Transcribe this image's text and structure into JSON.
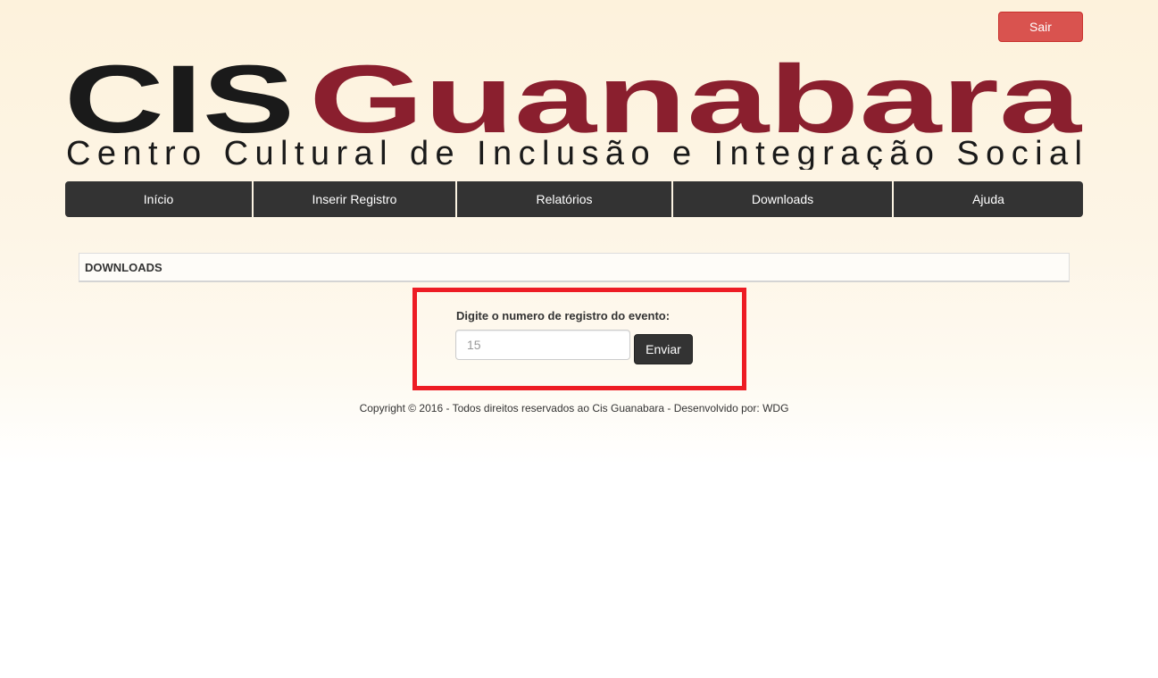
{
  "header": {
    "logout_label": "Sair",
    "logo": {
      "part1": "CIS",
      "part2": "Guanabara",
      "tagline": "Centro Cultural de Inclusão e Integração Social"
    }
  },
  "nav": {
    "items": [
      {
        "label": "Início"
      },
      {
        "label": "Inserir Registro"
      },
      {
        "label": "Relatórios"
      },
      {
        "label": "Downloads"
      },
      {
        "label": "Ajuda"
      }
    ]
  },
  "panel": {
    "title": "DOWNLOADS"
  },
  "form": {
    "label": "Digite o numero de registro do evento:",
    "placeholder": "15",
    "value": "",
    "submit_label": "Enviar"
  },
  "footer": {
    "text": "Copyright © 2016 - Todos direitos reservados ao Cis Guanabara - Desenvolvido por: WDG"
  },
  "colors": {
    "logo_dark": "#1a1a1a",
    "logo_accent": "#8a1f2e",
    "logout_button": "#d9534f",
    "nav_background": "#333333",
    "highlight_border": "#ed1c24"
  }
}
